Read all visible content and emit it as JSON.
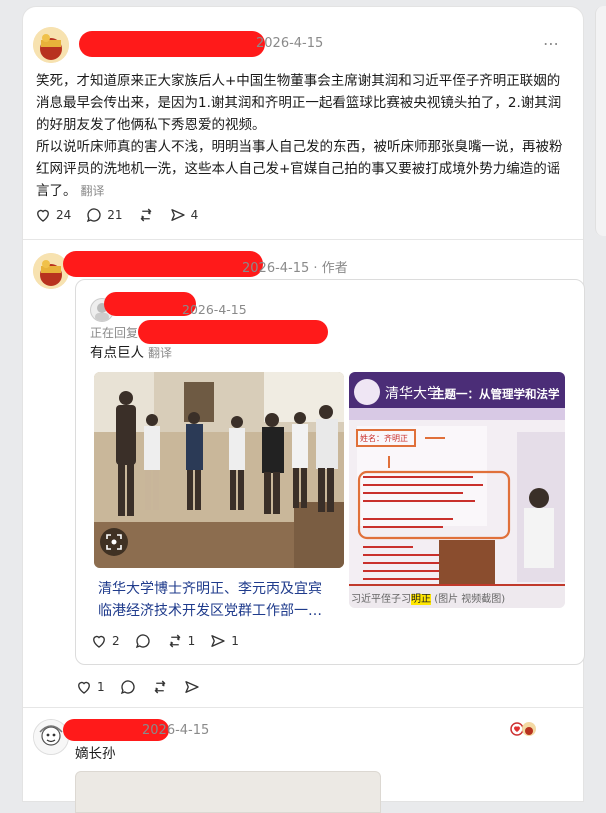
{
  "posts": [
    {
      "date": "2026-4-15",
      "paragraph1": "笑死，才知道原来正大家族后人+中国生物董事会主席谢其润和习近平侄子齐明正联姻的消息最早会传出来，是因为1.谢其润和齐明正一起看篮球比赛被央视镜头拍了，2.谢其润的好朋友发了他俩私下秀恩爱的视频。",
      "paragraph2": "所以说听床师真的害人不浅，明明当事人自己发的东西，被听床师那张臭嘴一说，再被粉红网评员的洗地机一洗，这些本人自己发+官媒自己拍的事又要被打成境外势力编造的谣言了。",
      "translate": "翻译",
      "likes": "24",
      "replies": "21",
      "reposts": "",
      "shares": "4"
    },
    {
      "date": "2026-4-15",
      "author_tag": "作者",
      "quoted": {
        "date": "2026-4-15",
        "replying": "正在回复",
        "text": "有点巨人",
        "translate": "翻译",
        "caption_line1": "清华大学博士齐明正、李元丙及宜宾",
        "caption_line2": "临港经济技术开发区党群工作部一…",
        "slide_title": "主题一：从管理学和法学",
        "slide_name_label": "姓名：",
        "slide_name_value": "齐明正",
        "slide_bottom_caption_a": "习近平侄子习",
        "slide_bottom_caption_b": "明正",
        "slide_bottom_caption_c": "(图片  视频截图)",
        "likes": "2",
        "replies": "",
        "reposts": "1",
        "shares": "1"
      },
      "likes": "1",
      "replies": "",
      "reposts": "",
      "shares": ""
    },
    {
      "date": "2026-4-15",
      "text": "嫡长孙"
    }
  ],
  "icons": {
    "more": "more-dots-icon",
    "like": "heart-icon",
    "reply": "comment-icon",
    "repost": "repost-icon",
    "share": "share-icon",
    "scan": "scan-icon"
  }
}
